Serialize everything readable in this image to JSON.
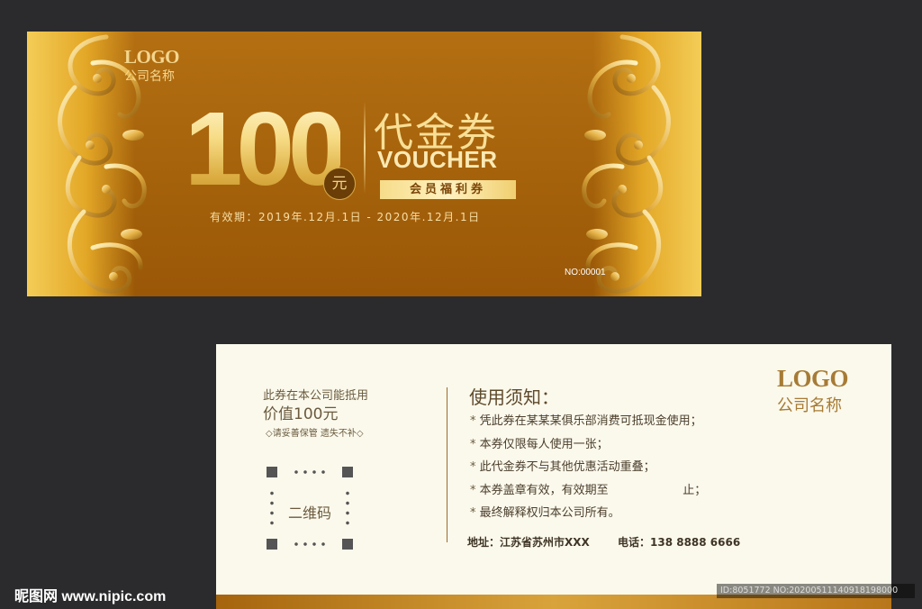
{
  "front": {
    "logo": "LOGO",
    "company": "公司名称",
    "amount": "100",
    "currency_badge": "元",
    "title_cn": "代金券",
    "title_en": "VOUCHER",
    "member_tag": "会员福利券",
    "validity": "有效期：2019年.12月.1日 - 2020年.12月.1日",
    "serial": "NO:00001"
  },
  "back": {
    "use_text": "此券在本公司能抵用",
    "use_value": "价值100元",
    "keep_note": "◇请妥善保管 遗失不补◇",
    "qr_label": "二维码",
    "notice_title": "使用须知：",
    "notices": [
      "凭此券在某某某俱乐部消费可抵现金使用；",
      "本券仅限每人使用一张；",
      "此代金券不与其他优惠活动重叠；",
      "本券盖章有效，有效期至                    止；",
      "最终解释权归本公司所有。"
    ],
    "address": "地址：江苏省苏州市XXX",
    "phone": "电话：138 8888 6666",
    "logo": "LOGO",
    "company": "公司名称"
  },
  "watermark": {
    "site": "昵图网 www.nipic.com",
    "id": "ID:8051772 NO:20200511140918198000"
  },
  "colors": {
    "gold": "#f3d68e",
    "bronze": "#a5620b",
    "cream": "#fbf9ec",
    "background": "#2b2b2d"
  }
}
